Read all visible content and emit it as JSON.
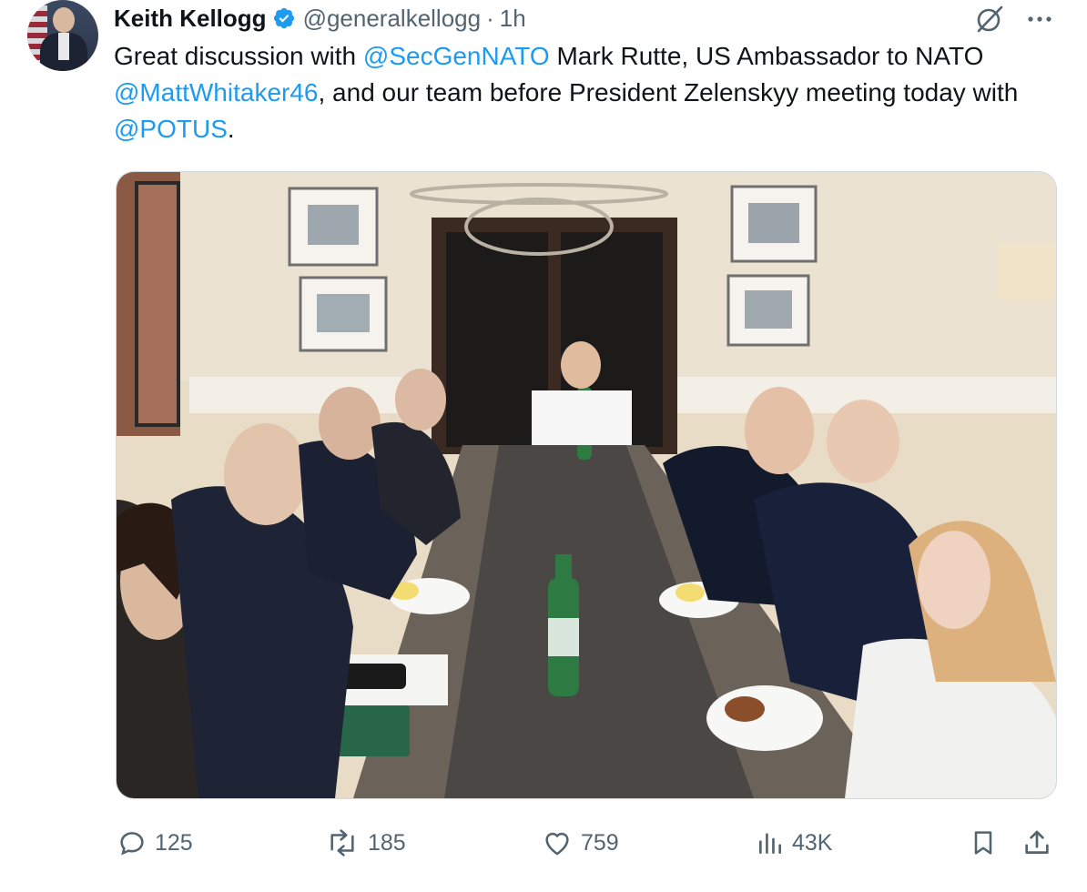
{
  "author": {
    "display_name": "Keith Kellogg",
    "handle": "@generalkellogg",
    "separator": "·",
    "time": "1h"
  },
  "tweet": {
    "seg1": "Great discussion with ",
    "mention1": "@SecGenNATO",
    "seg2": " Mark Rutte, US Ambassador to NATO ",
    "mention2": "@MattWhitaker46",
    "seg3": ", and our team before President Zelenskyy meeting today with ",
    "mention3": "@POTUS",
    "seg4": "."
  },
  "metrics": {
    "replies": "125",
    "reposts": "185",
    "likes": "759",
    "views": "43K"
  },
  "icons": {
    "verified": "verified-badge-icon",
    "grok": "grok-icon",
    "more": "more-icon",
    "reply": "reply-icon",
    "repost": "repost-icon",
    "like": "like-icon",
    "views": "views-icon",
    "bookmark": "bookmark-icon",
    "share": "share-icon"
  },
  "colors": {
    "accent": "#1d9bf0",
    "text": "#0f1419",
    "secondary": "#536471"
  }
}
